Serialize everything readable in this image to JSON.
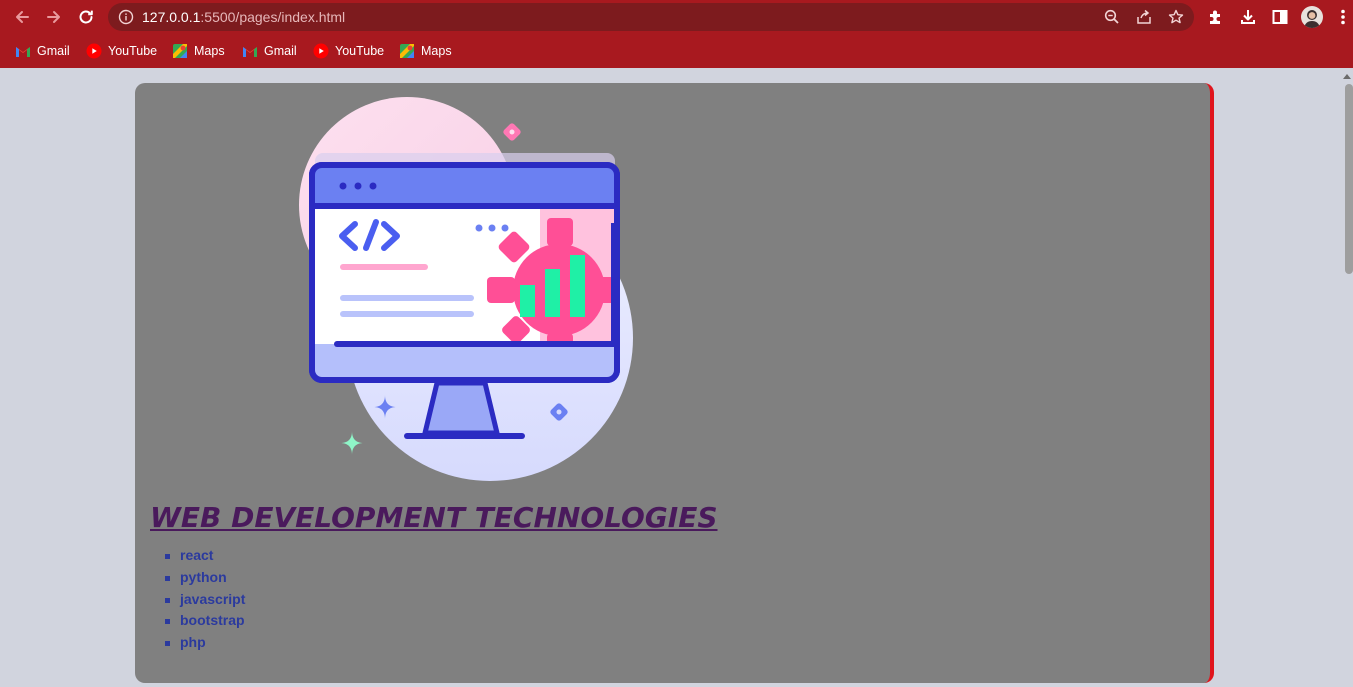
{
  "browser": {
    "url_host": "127.0.0.1",
    "url_rest": ":5500/pages/index.html",
    "nav": {
      "back": "arrow-left-icon",
      "forward": "arrow-right-icon",
      "reload": "reload-icon"
    },
    "omnibox_actions": [
      "zoom-icon",
      "share-icon",
      "star-icon"
    ],
    "toolbar_actions": [
      "extensions-icon",
      "download-icon",
      "side-panel-icon",
      "menu-dots-icon"
    ],
    "colors": {
      "toolbar": "#a8191f",
      "omnibox": "#7d1b1e"
    }
  },
  "bookmarks": [
    {
      "label": "Gmail",
      "icon": "gmail-icon"
    },
    {
      "label": "YouTube",
      "icon": "youtube-icon"
    },
    {
      "label": "Maps",
      "icon": "maps-icon"
    },
    {
      "label": "Gmail",
      "icon": "gmail-icon"
    },
    {
      "label": "YouTube",
      "icon": "youtube-icon"
    },
    {
      "label": "Maps",
      "icon": "maps-icon"
    }
  ],
  "page": {
    "title": "WEB DEVELOPMENT TECHNOLOGIES",
    "technologies": [
      "react",
      "python",
      "javascript",
      "bootstrap",
      "php"
    ],
    "colors": {
      "background": "#d1d4de",
      "card": "#808080",
      "card_border": "#e0141c",
      "title": "#4a1a5c",
      "list": "#2b3a9e"
    }
  }
}
